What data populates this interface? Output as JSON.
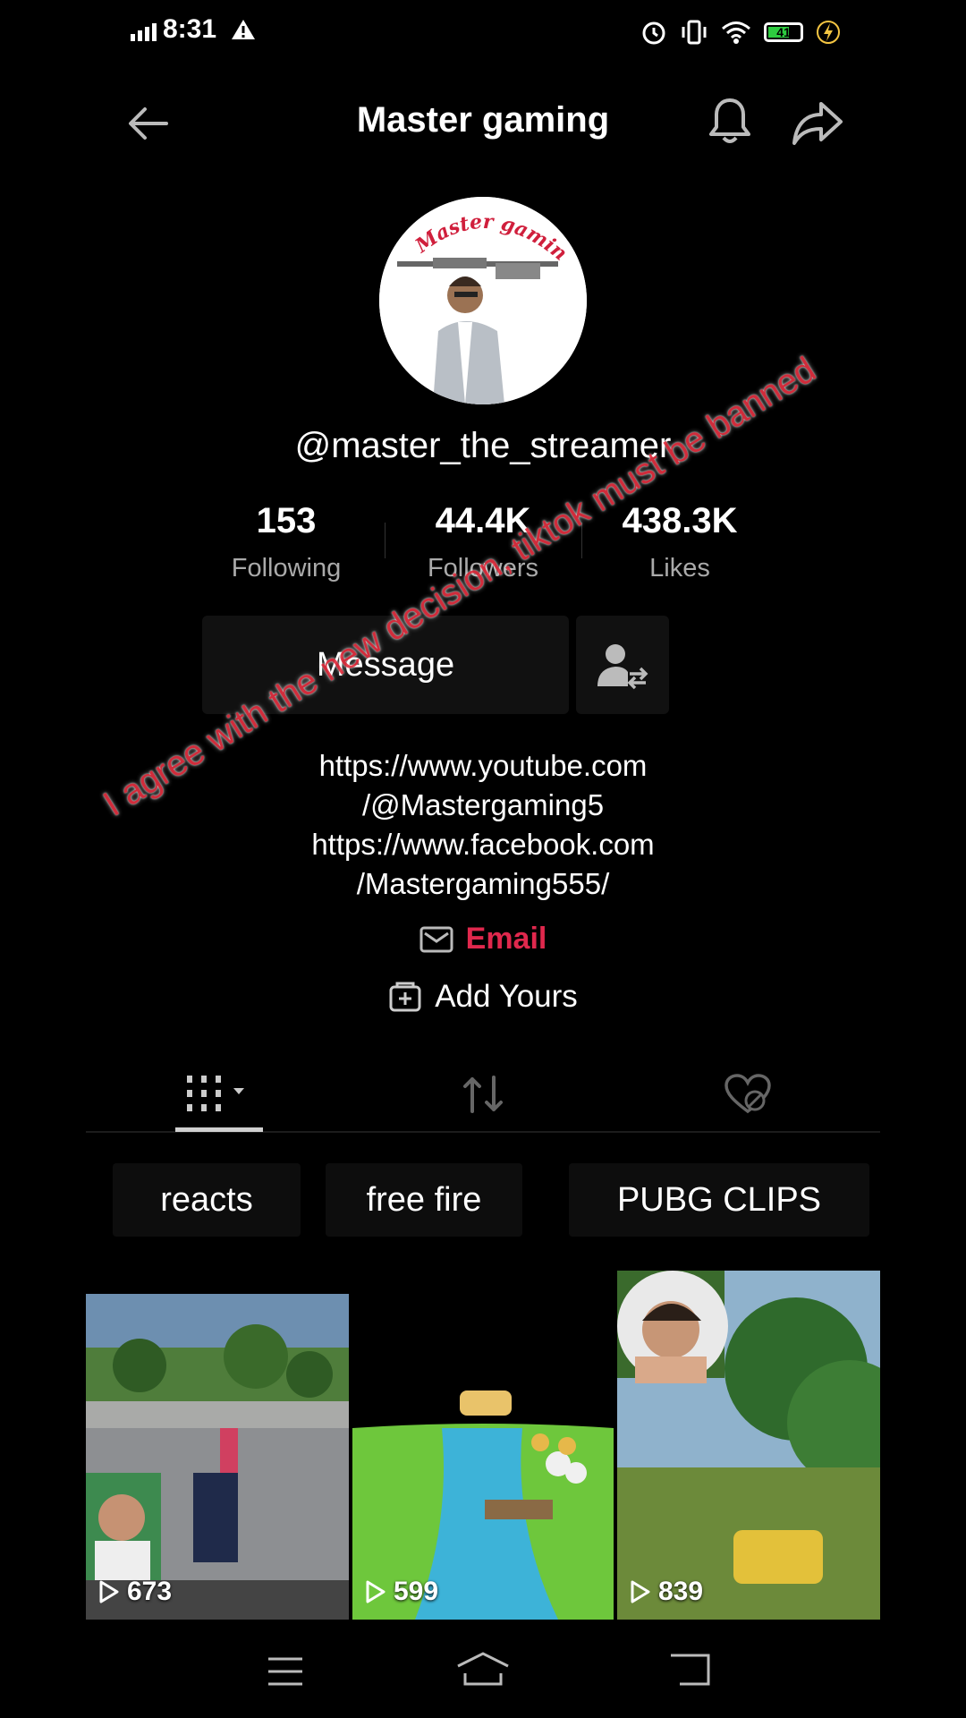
{
  "status_bar": {
    "time": "8:31",
    "battery": "41"
  },
  "header": {
    "title": "Master gaming"
  },
  "profile": {
    "avatar_text": "Master gaming",
    "username": "@master_the_streamer",
    "stats": [
      {
        "value": "153",
        "label": "Following"
      },
      {
        "value": "44.4K",
        "label": "Followers"
      },
      {
        "value": "438.3K",
        "label": "Likes"
      }
    ],
    "message_label": "Message",
    "bio_lines": [
      "https://www.youtube.com",
      "/@Mastergaming5",
      "https://www.facebook.com",
      "/Mastergaming555/"
    ],
    "email_label": "Email",
    "add_yours_label": "Add Yours"
  },
  "overlay_text": "I agree with the new decision, tiktok must be banned",
  "playlists": [
    "reacts",
    "free fire",
    "PUBG CLIPS"
  ],
  "videos": [
    {
      "views": "673"
    },
    {
      "views": "599"
    },
    {
      "views": "839"
    }
  ],
  "colors": {
    "email": "#e0284d",
    "background": "#000000"
  }
}
